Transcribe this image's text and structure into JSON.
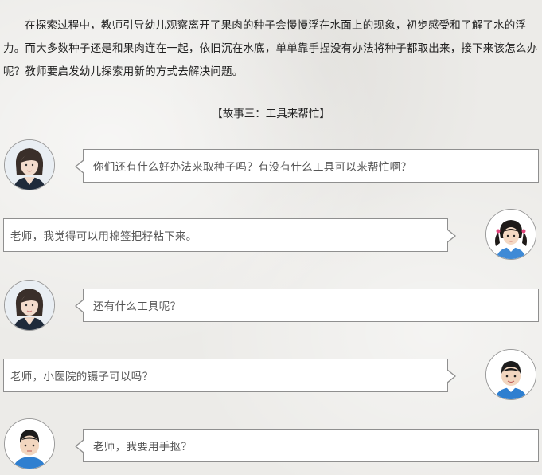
{
  "intro": "在探索过程中，教师引导幼儿观察离开了果肉的种子会慢慢浮在水面上的现象，初步感受和了解了水的浮力。而大多数种子还是和果肉连在一起，依旧沉在水底，单单靠手捏没有办法将种子都取出来，接下来该怎么办呢？教师要启发幼儿探索用新的方式去解决问题。",
  "section_title": "【故事三：工具来帮忙】",
  "dialogue": [
    {
      "speaker": "teacher",
      "text": "你们还有什么好办法来取种子吗？有没有什么工具可以来帮忙啊？"
    },
    {
      "speaker": "child-girl",
      "text": "老师，我觉得可以用棉签把籽粘下来。"
    },
    {
      "speaker": "teacher",
      "text": "还有什么工具呢？"
    },
    {
      "speaker": "child-boy",
      "text": "老师，小医院的镊子可以吗？"
    },
    {
      "speaker": "child-boy-2",
      "text": "老师，我要用手抠？"
    }
  ]
}
